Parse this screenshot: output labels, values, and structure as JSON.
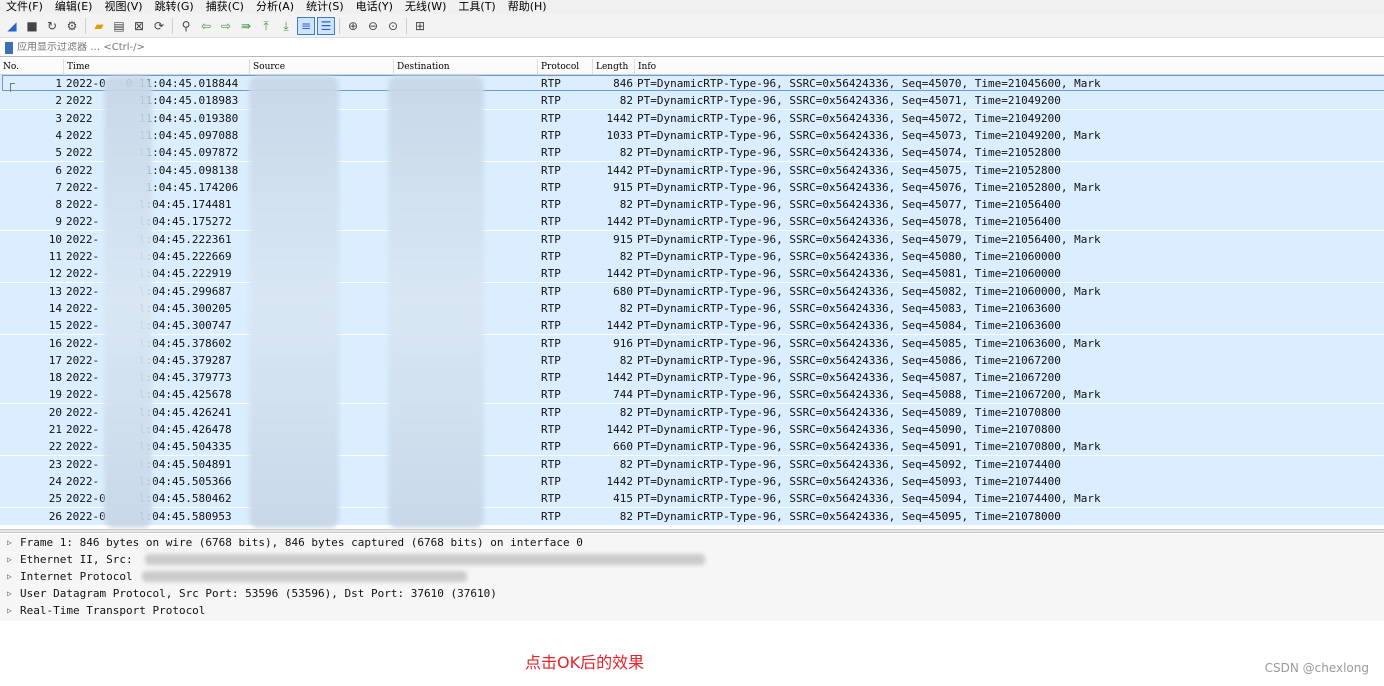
{
  "menu": [
    "文件(F)",
    "编辑(E)",
    "视图(V)",
    "跳转(G)",
    "捕获(C)",
    "分析(A)",
    "统计(S)",
    "电话(Y)",
    "无线(W)",
    "工具(T)",
    "帮助(H)"
  ],
  "toolbar": {
    "icons": [
      "shark-fin-start-icon",
      "stop-icon",
      "restart-icon",
      "capture-options-icon",
      "open-folder-icon",
      "save-icon",
      "close-file-icon",
      "reload-icon",
      "find-icon",
      "go-back-icon",
      "go-forward-icon",
      "go-to-packet-icon",
      "first-packet-icon",
      "last-packet-icon",
      "autoscroll-icon",
      "colorize-icon",
      "zoom-in-icon",
      "zoom-out-icon",
      "zoom-normal-icon",
      "resize-columns-icon"
    ]
  },
  "filter": {
    "placeholder": "应用显示过滤器 … <Ctrl-/>"
  },
  "columns": [
    "No.",
    "Time",
    "Source",
    "Destination",
    "Protocol",
    "Length",
    "Info"
  ],
  "packets": [
    {
      "no": "1",
      "time": "2022-0   0 11:04:45.018844",
      "protocol": "RTP",
      "length": "846",
      "info": "PT=DynamicRTP-Type-96, SSRC=0x56424336, Seq=45070, Time=21045600, Mark"
    },
    {
      "no": "2",
      "time": "2022       11:04:45.018983",
      "protocol": "RTP",
      "length": "82",
      "info": "PT=DynamicRTP-Type-96, SSRC=0x56424336, Seq=45071, Time=21049200"
    },
    {
      "no": "3",
      "time": "2022       11:04:45.019380",
      "protocol": "RTP",
      "length": "1442",
      "info": "PT=DynamicRTP-Type-96, SSRC=0x56424336, Seq=45072, Time=21049200"
    },
    {
      "no": "4",
      "time": "2022       11:04:45.097088",
      "protocol": "RTP",
      "length": "1033",
      "info": "PT=DynamicRTP-Type-96, SSRC=0x56424336, Seq=45073, Time=21049200, Mark"
    },
    {
      "no": "5",
      "time": "2022       l1:04:45.097872",
      "protocol": "RTP",
      "length": "82",
      "info": "PT=DynamicRTP-Type-96, SSRC=0x56424336, Seq=45074, Time=21052800"
    },
    {
      "no": "6",
      "time": "2022        1:04:45.098138",
      "protocol": "RTP",
      "length": "1442",
      "info": "PT=DynamicRTP-Type-96, SSRC=0x56424336, Seq=45075, Time=21052800"
    },
    {
      "no": "7",
      "time": "2022-       1:04:45.174206",
      "protocol": "RTP",
      "length": "915",
      "info": "PT=DynamicRTP-Type-96, SSRC=0x56424336, Seq=45076, Time=21052800, Mark"
    },
    {
      "no": "8",
      "time": "2022-      l:04:45.174481",
      "protocol": "RTP",
      "length": "82",
      "info": "PT=DynamicRTP-Type-96, SSRC=0x56424336, Seq=45077, Time=21056400"
    },
    {
      "no": "9",
      "time": "2022-      l:04:45.175272",
      "protocol": "RTP",
      "length": "1442",
      "info": "PT=DynamicRTP-Type-96, SSRC=0x56424336, Seq=45078, Time=21056400"
    },
    {
      "no": "10",
      "time": "2022-      l:04:45.222361",
      "protocol": "RTP",
      "length": "915",
      "info": "PT=DynamicRTP-Type-96, SSRC=0x56424336, Seq=45079, Time=21056400, Mark"
    },
    {
      "no": "11",
      "time": "2022-      l:04:45.222669",
      "protocol": "RTP",
      "length": "82",
      "info": "PT=DynamicRTP-Type-96, SSRC=0x56424336, Seq=45080, Time=21060000"
    },
    {
      "no": "12",
      "time": "2022-      l:04:45.222919",
      "protocol": "RTP",
      "length": "1442",
      "info": "PT=DynamicRTP-Type-96, SSRC=0x56424336, Seq=45081, Time=21060000"
    },
    {
      "no": "13",
      "time": "2022-      l:04:45.299687",
      "protocol": "RTP",
      "length": "680",
      "info": "PT=DynamicRTP-Type-96, SSRC=0x56424336, Seq=45082, Time=21060000, Mark"
    },
    {
      "no": "14",
      "time": "2022-      l:04:45.300205",
      "protocol": "RTP",
      "length": "82",
      "info": "PT=DynamicRTP-Type-96, SSRC=0x56424336, Seq=45083, Time=21063600"
    },
    {
      "no": "15",
      "time": "2022-      l:04:45.300747",
      "protocol": "RTP",
      "length": "1442",
      "info": "PT=DynamicRTP-Type-96, SSRC=0x56424336, Seq=45084, Time=21063600"
    },
    {
      "no": "16",
      "time": "2022-      l:04:45.378602",
      "protocol": "RTP",
      "length": "916",
      "info": "PT=DynamicRTP-Type-96, SSRC=0x56424336, Seq=45085, Time=21063600, Mark"
    },
    {
      "no": "17",
      "time": "2022-      l:04:45.379287",
      "protocol": "RTP",
      "length": "82",
      "info": "PT=DynamicRTP-Type-96, SSRC=0x56424336, Seq=45086, Time=21067200"
    },
    {
      "no": "18",
      "time": "2022-      l:04:45.379773",
      "protocol": "RTP",
      "length": "1442",
      "info": "PT=DynamicRTP-Type-96, SSRC=0x56424336, Seq=45087, Time=21067200"
    },
    {
      "no": "19",
      "time": "2022-      l:04:45.425678",
      "protocol": "RTP",
      "length": "744",
      "info": "PT=DynamicRTP-Type-96, SSRC=0x56424336, Seq=45088, Time=21067200, Mark"
    },
    {
      "no": "20",
      "time": "2022-      l:04:45.426241",
      "protocol": "RTP",
      "length": "82",
      "info": "PT=DynamicRTP-Type-96, SSRC=0x56424336, Seq=45089, Time=21070800"
    },
    {
      "no": "21",
      "time": "2022-      l:04:45.426478",
      "protocol": "RTP",
      "length": "1442",
      "info": "PT=DynamicRTP-Type-96, SSRC=0x56424336, Seq=45090, Time=21070800"
    },
    {
      "no": "22",
      "time": "2022-      l:04:45.504335",
      "protocol": "RTP",
      "length": "660",
      "info": "PT=DynamicRTP-Type-96, SSRC=0x56424336, Seq=45091, Time=21070800, Mark"
    },
    {
      "no": "23",
      "time": "2022-      l:04:45.504891",
      "protocol": "RTP",
      "length": "82",
      "info": "PT=DynamicRTP-Type-96, SSRC=0x56424336, Seq=45092, Time=21074400"
    },
    {
      "no": "24",
      "time": "2022-      l:04:45.505366",
      "protocol": "RTP",
      "length": "1442",
      "info": "PT=DynamicRTP-Type-96, SSRC=0x56424336, Seq=45093, Time=21074400"
    },
    {
      "no": "25",
      "time": "2022-0     l:04:45.580462",
      "protocol": "RTP",
      "length": "415",
      "info": "PT=DynamicRTP-Type-96, SSRC=0x56424336, Seq=45094, Time=21074400, Mark"
    },
    {
      "no": "26",
      "time": "2022-0     l:04:45.580953",
      "protocol": "RTP",
      "length": "82",
      "info": "PT=DynamicRTP-Type-96, SSRC=0x56424336, Seq=45095, Time=21078000"
    }
  ],
  "details": [
    "Frame 1: 846 bytes on wire (6768 bits), 846 bytes captured (6768 bits) on interface 0",
    "Ethernet II, Src:",
    "Internet Protocol",
    "User Datagram Protocol, Src Port: 53596 (53596), Dst Port: 37610 (37610)",
    "Real-Time Transport Protocol"
  ],
  "caption": "点击OK后的效果",
  "watermark": "CSDN @chexlong",
  "colors": {
    "row_bg": "#daeeff",
    "caption": "#e8222a"
  }
}
